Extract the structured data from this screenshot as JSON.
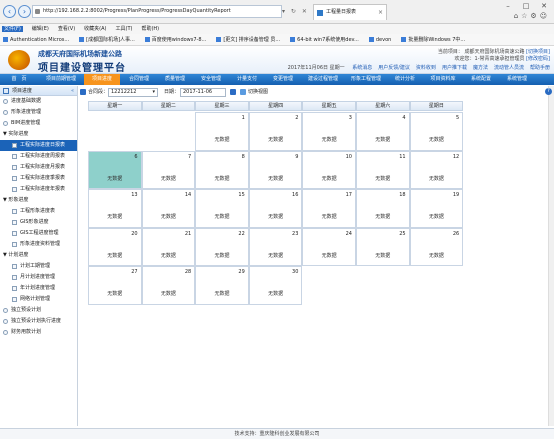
{
  "browser": {
    "url": "http://192.168.2.2:8002/Progress/PlanProgress/ProgressDayQuantityReport",
    "tab_title": "工程量日报表",
    "menu": [
      "文件(F)",
      "编辑(E)",
      "查看(V)",
      "收藏夹(A)",
      "工具(T)",
      "帮助(H)"
    ],
    "favorites": [
      "Authentication Micros...",
      "[成都国际机场]人事...",
      "百度使用windows7-8...",
      "[更文] 排序设备管理 员...",
      "64-bit win7系统使用dev...",
      "devon",
      "批量删除Windows 7中..."
    ]
  },
  "header": {
    "sub_title": "成都天府国际机场新建公路",
    "main_title": "项目建设管理平台",
    "project_label": "当前项目：",
    "project_name": "成都天府国际机场高速公路",
    "switch_project": "[切换项目]",
    "welcome": "欢迎您：1-常青高速承担管理员 ",
    "change_pwd": "[修改密码]",
    "date_line": "2017年11月06日 星期一",
    "quick_links": [
      "系统消息",
      "用户反馈/建议",
      "资料收到",
      "用户推下载",
      "魔方法",
      "流动管人员流",
      "帮助手册"
    ]
  },
  "nav": [
    "首　页",
    "项目前期管理",
    "项目进度",
    "合同管理",
    "质量管理",
    "安全管理",
    "计量支付",
    "变更管理",
    "建设过程管理",
    "形象工程管理",
    "统计分析",
    "项目资料库",
    "系统配置",
    "系统管理"
  ],
  "sidebar": {
    "title": "项目进度",
    "items": [
      {
        "label": "进度基础数据",
        "level": 1,
        "kind": "dot"
      },
      {
        "label": "形象进度管理",
        "level": 1,
        "kind": "dot"
      },
      {
        "label": "BIM进度管理",
        "level": 1,
        "kind": "dot"
      },
      {
        "label": "▼ 实际进度",
        "level": 0,
        "kind": "group"
      },
      {
        "label": "工程实际进度日报表",
        "level": 2,
        "kind": "sq",
        "selected": true
      },
      {
        "label": "工程实际进度周报表",
        "level": 2,
        "kind": "sq"
      },
      {
        "label": "工程实际进度月报表",
        "level": 2,
        "kind": "sq"
      },
      {
        "label": "工程实际进度季报表",
        "level": 2,
        "kind": "sq"
      },
      {
        "label": "工程实际进度年报表",
        "level": 2,
        "kind": "sq"
      },
      {
        "label": "▼ 形象进度",
        "level": 0,
        "kind": "group"
      },
      {
        "label": "工程形象进度表",
        "level": 2,
        "kind": "sq"
      },
      {
        "label": "GIS形象进度",
        "level": 2,
        "kind": "sq"
      },
      {
        "label": "GIS工程进度管理",
        "level": 2,
        "kind": "sq"
      },
      {
        "label": "形象进度资料管理",
        "level": 2,
        "kind": "sq"
      },
      {
        "label": "▼ 计划进度",
        "level": 0,
        "kind": "group"
      },
      {
        "label": "计划工期管理",
        "level": 2,
        "kind": "sq"
      },
      {
        "label": "月计划进度管理",
        "level": 2,
        "kind": "sq"
      },
      {
        "label": "年计划进度管理",
        "level": 2,
        "kind": "sq"
      },
      {
        "label": "网络计划管理",
        "level": 2,
        "kind": "sq"
      },
      {
        "label": "独立预设计划",
        "level": 1,
        "kind": "dot"
      },
      {
        "label": "独立预设计划执行进度",
        "level": 1,
        "kind": "dot"
      },
      {
        "label": "财务用款计划",
        "level": 1,
        "kind": "dot"
      }
    ]
  },
  "toolbar": {
    "section_label": "合同段：",
    "section_value": "12212212",
    "date_label": "日期：",
    "date_value": "2017-11-06",
    "switch_label": "切换视图"
  },
  "calendar": {
    "weekdays": [
      "星期一",
      "星期二",
      "星期三",
      "星期四",
      "星期五",
      "星期六",
      "星期日"
    ],
    "first_weekday_index": 2,
    "days": 30,
    "today": 6,
    "cell_text": "无数据"
  },
  "footer": "技术支持：重庆隆科创业发展有限公司"
}
